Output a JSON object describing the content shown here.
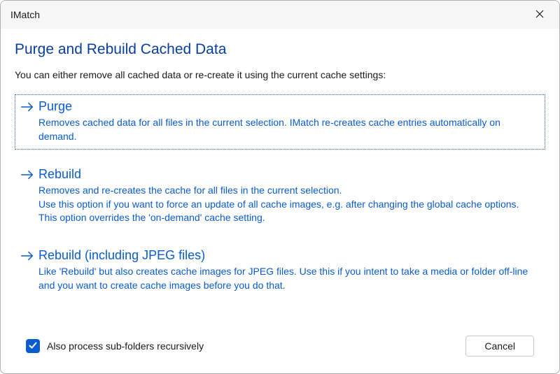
{
  "window": {
    "title": "IMatch"
  },
  "header": {
    "title": "Purge and Rebuild Cached Data",
    "intro": "You can either remove all cached data or re-create it using the current cache settings:"
  },
  "options": [
    {
      "title": "Purge",
      "desc": "Removes cached data for all files in the current selection. IMatch re-creates cache entries automatically on demand.",
      "focused": true
    },
    {
      "title": "Rebuild",
      "desc": "Removes and re-creates the cache for all files in the current selection.\nUse this option if you want to force an update of all cache images, e.g. after changing the global cache options.\nThis option overrides the 'on-demand' cache setting.",
      "focused": false
    },
    {
      "title": "Rebuild (including JPEG files)",
      "desc": "Like 'Rebuild' but also creates cache images for JPEG files. Use this if you intent to take a media or folder off-line and you want to create cache images before you do that.",
      "focused": false
    }
  ],
  "footer": {
    "checkbox_label": "Also process sub-folders recursively",
    "checkbox_checked": true,
    "cancel_label": "Cancel"
  }
}
